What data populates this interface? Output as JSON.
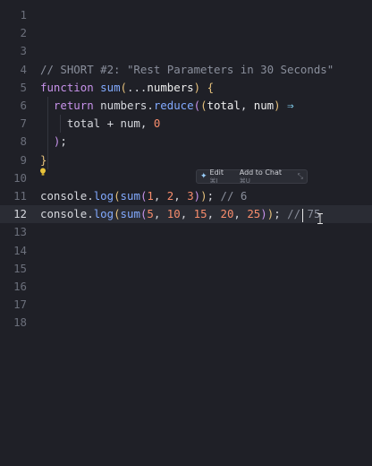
{
  "editor": {
    "lines": [
      {
        "n": "1",
        "tokens": []
      },
      {
        "n": "2",
        "tokens": []
      },
      {
        "n": "3",
        "tokens": []
      },
      {
        "n": "4",
        "tokens": [
          [
            "comment",
            "// SHORT #2: \"Rest Parameters in 30 Seconds\""
          ]
        ]
      },
      {
        "n": "5",
        "tokens": [
          [
            "keyword",
            "function"
          ],
          [
            "plain",
            " "
          ],
          [
            "func",
            "sum"
          ],
          [
            "paren",
            "("
          ],
          [
            "spread",
            "..."
          ],
          [
            "param",
            "numbers"
          ],
          [
            "paren",
            ")"
          ],
          [
            "plain",
            " "
          ],
          [
            "paren",
            "{"
          ]
        ]
      },
      {
        "n": "6",
        "tokens": [
          [
            "plain",
            "  "
          ],
          [
            "keyword",
            "return"
          ],
          [
            "plain",
            " numbers."
          ],
          [
            "func",
            "reduce"
          ],
          [
            "paren2",
            "("
          ],
          [
            "paren",
            "("
          ],
          [
            "param",
            "total"
          ],
          [
            "plain",
            ", "
          ],
          [
            "param",
            "num"
          ],
          [
            "paren",
            ")"
          ],
          [
            "plain",
            " "
          ],
          [
            "arrow",
            "⇒"
          ]
        ]
      },
      {
        "n": "7",
        "tokens": [
          [
            "plain",
            "    total + num, "
          ],
          [
            "number",
            "0"
          ]
        ]
      },
      {
        "n": "8",
        "tokens": [
          [
            "plain",
            "  "
          ],
          [
            "paren2",
            ")"
          ],
          [
            "plain",
            ";"
          ]
        ]
      },
      {
        "n": "9",
        "tokens": [
          [
            "paren",
            "}"
          ]
        ]
      },
      {
        "n": "10",
        "tokens": []
      },
      {
        "n": "11",
        "tokens": [
          [
            "plain",
            "console."
          ],
          [
            "func",
            "log"
          ],
          [
            "paren",
            "("
          ],
          [
            "func",
            "sum"
          ],
          [
            "paren2",
            "("
          ],
          [
            "number",
            "1"
          ],
          [
            "plain",
            ", "
          ],
          [
            "number",
            "2"
          ],
          [
            "plain",
            ", "
          ],
          [
            "number",
            "3"
          ],
          [
            "paren2",
            ")"
          ],
          [
            "paren",
            ")"
          ],
          [
            "plain",
            "; "
          ],
          [
            "comment",
            "// 6"
          ]
        ]
      },
      {
        "n": "12",
        "tokens": [
          [
            "plain",
            "console."
          ],
          [
            "func",
            "log"
          ],
          [
            "paren",
            "("
          ],
          [
            "func",
            "sum"
          ],
          [
            "paren2",
            "("
          ],
          [
            "number",
            "5"
          ],
          [
            "plain",
            ", "
          ],
          [
            "number",
            "10"
          ],
          [
            "plain",
            ", "
          ],
          [
            "number",
            "15"
          ],
          [
            "plain",
            ", "
          ],
          [
            "number",
            "20"
          ],
          [
            "plain",
            ", "
          ],
          [
            "number",
            "25"
          ],
          [
            "paren2",
            ")"
          ],
          [
            "paren",
            ")"
          ],
          [
            "plain",
            "; "
          ],
          [
            "comment",
            "// 75"
          ]
        ],
        "current": true
      },
      {
        "n": "13",
        "tokens": []
      },
      {
        "n": "14",
        "tokens": []
      },
      {
        "n": "15",
        "tokens": []
      },
      {
        "n": "16",
        "tokens": []
      },
      {
        "n": "17",
        "tokens": []
      },
      {
        "n": "18",
        "tokens": []
      }
    ]
  },
  "inline_menu": {
    "edit_label": "Edit",
    "edit_shortcut": "⌘I",
    "chat_label": "Add to Chat",
    "chat_shortcut": "⌘U",
    "sparkle_icon": "sparkle-icon",
    "expand_icon": "expand-icon"
  }
}
